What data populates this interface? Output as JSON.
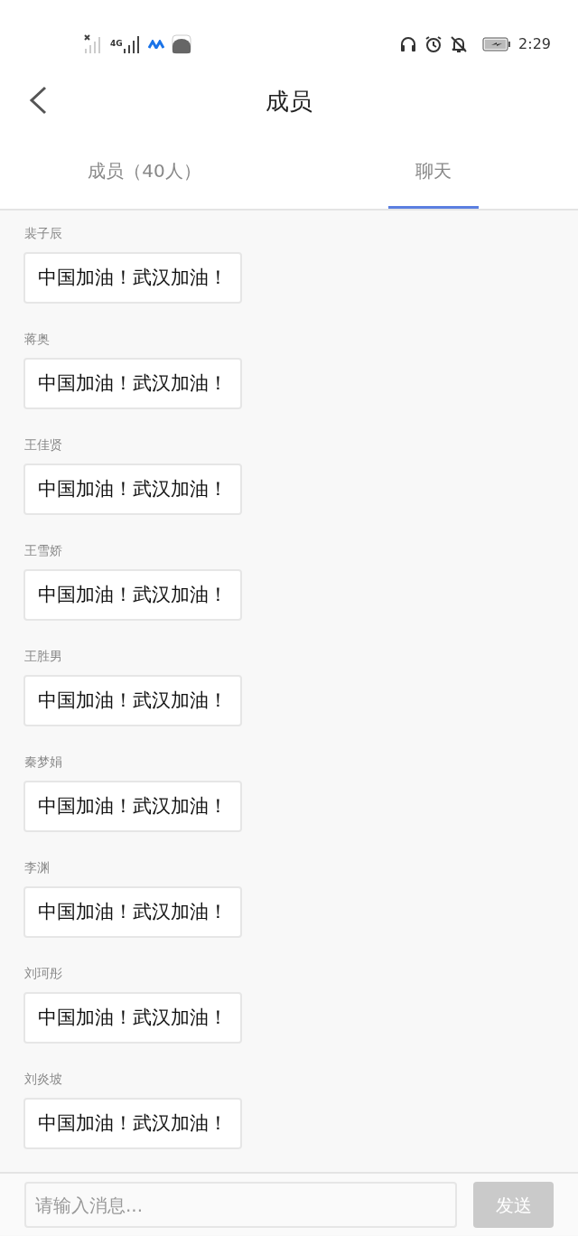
{
  "status_bar": {
    "network": "4G",
    "time": "2:29"
  },
  "header": {
    "title": "成员"
  },
  "tabs": [
    {
      "label": "成员（40人）",
      "selected": false
    },
    {
      "label": "聊天",
      "selected": true
    }
  ],
  "messages": [
    {
      "sender": "裴子辰",
      "text": "中国加油！武汉加油！"
    },
    {
      "sender": "蒋奥",
      "text": "中国加油！武汉加油！"
    },
    {
      "sender": "王佳贤",
      "text": "中国加油！武汉加油！"
    },
    {
      "sender": "王雪娇",
      "text": "中国加油！武汉加油！"
    },
    {
      "sender": "王胜男",
      "text": "中国加油！武汉加油！"
    },
    {
      "sender": "秦梦娟",
      "text": "中国加油！武汉加油！"
    },
    {
      "sender": "李渊",
      "text": "中国加油！武汉加油！"
    },
    {
      "sender": "刘珂彤",
      "text": "中国加油！武汉加油！"
    },
    {
      "sender": "刘炎坡",
      "text": "中国加油！武汉加油！"
    }
  ],
  "composer": {
    "placeholder": "请输入消息...",
    "send_button": {
      "label": "发送",
      "disabled": true
    }
  }
}
